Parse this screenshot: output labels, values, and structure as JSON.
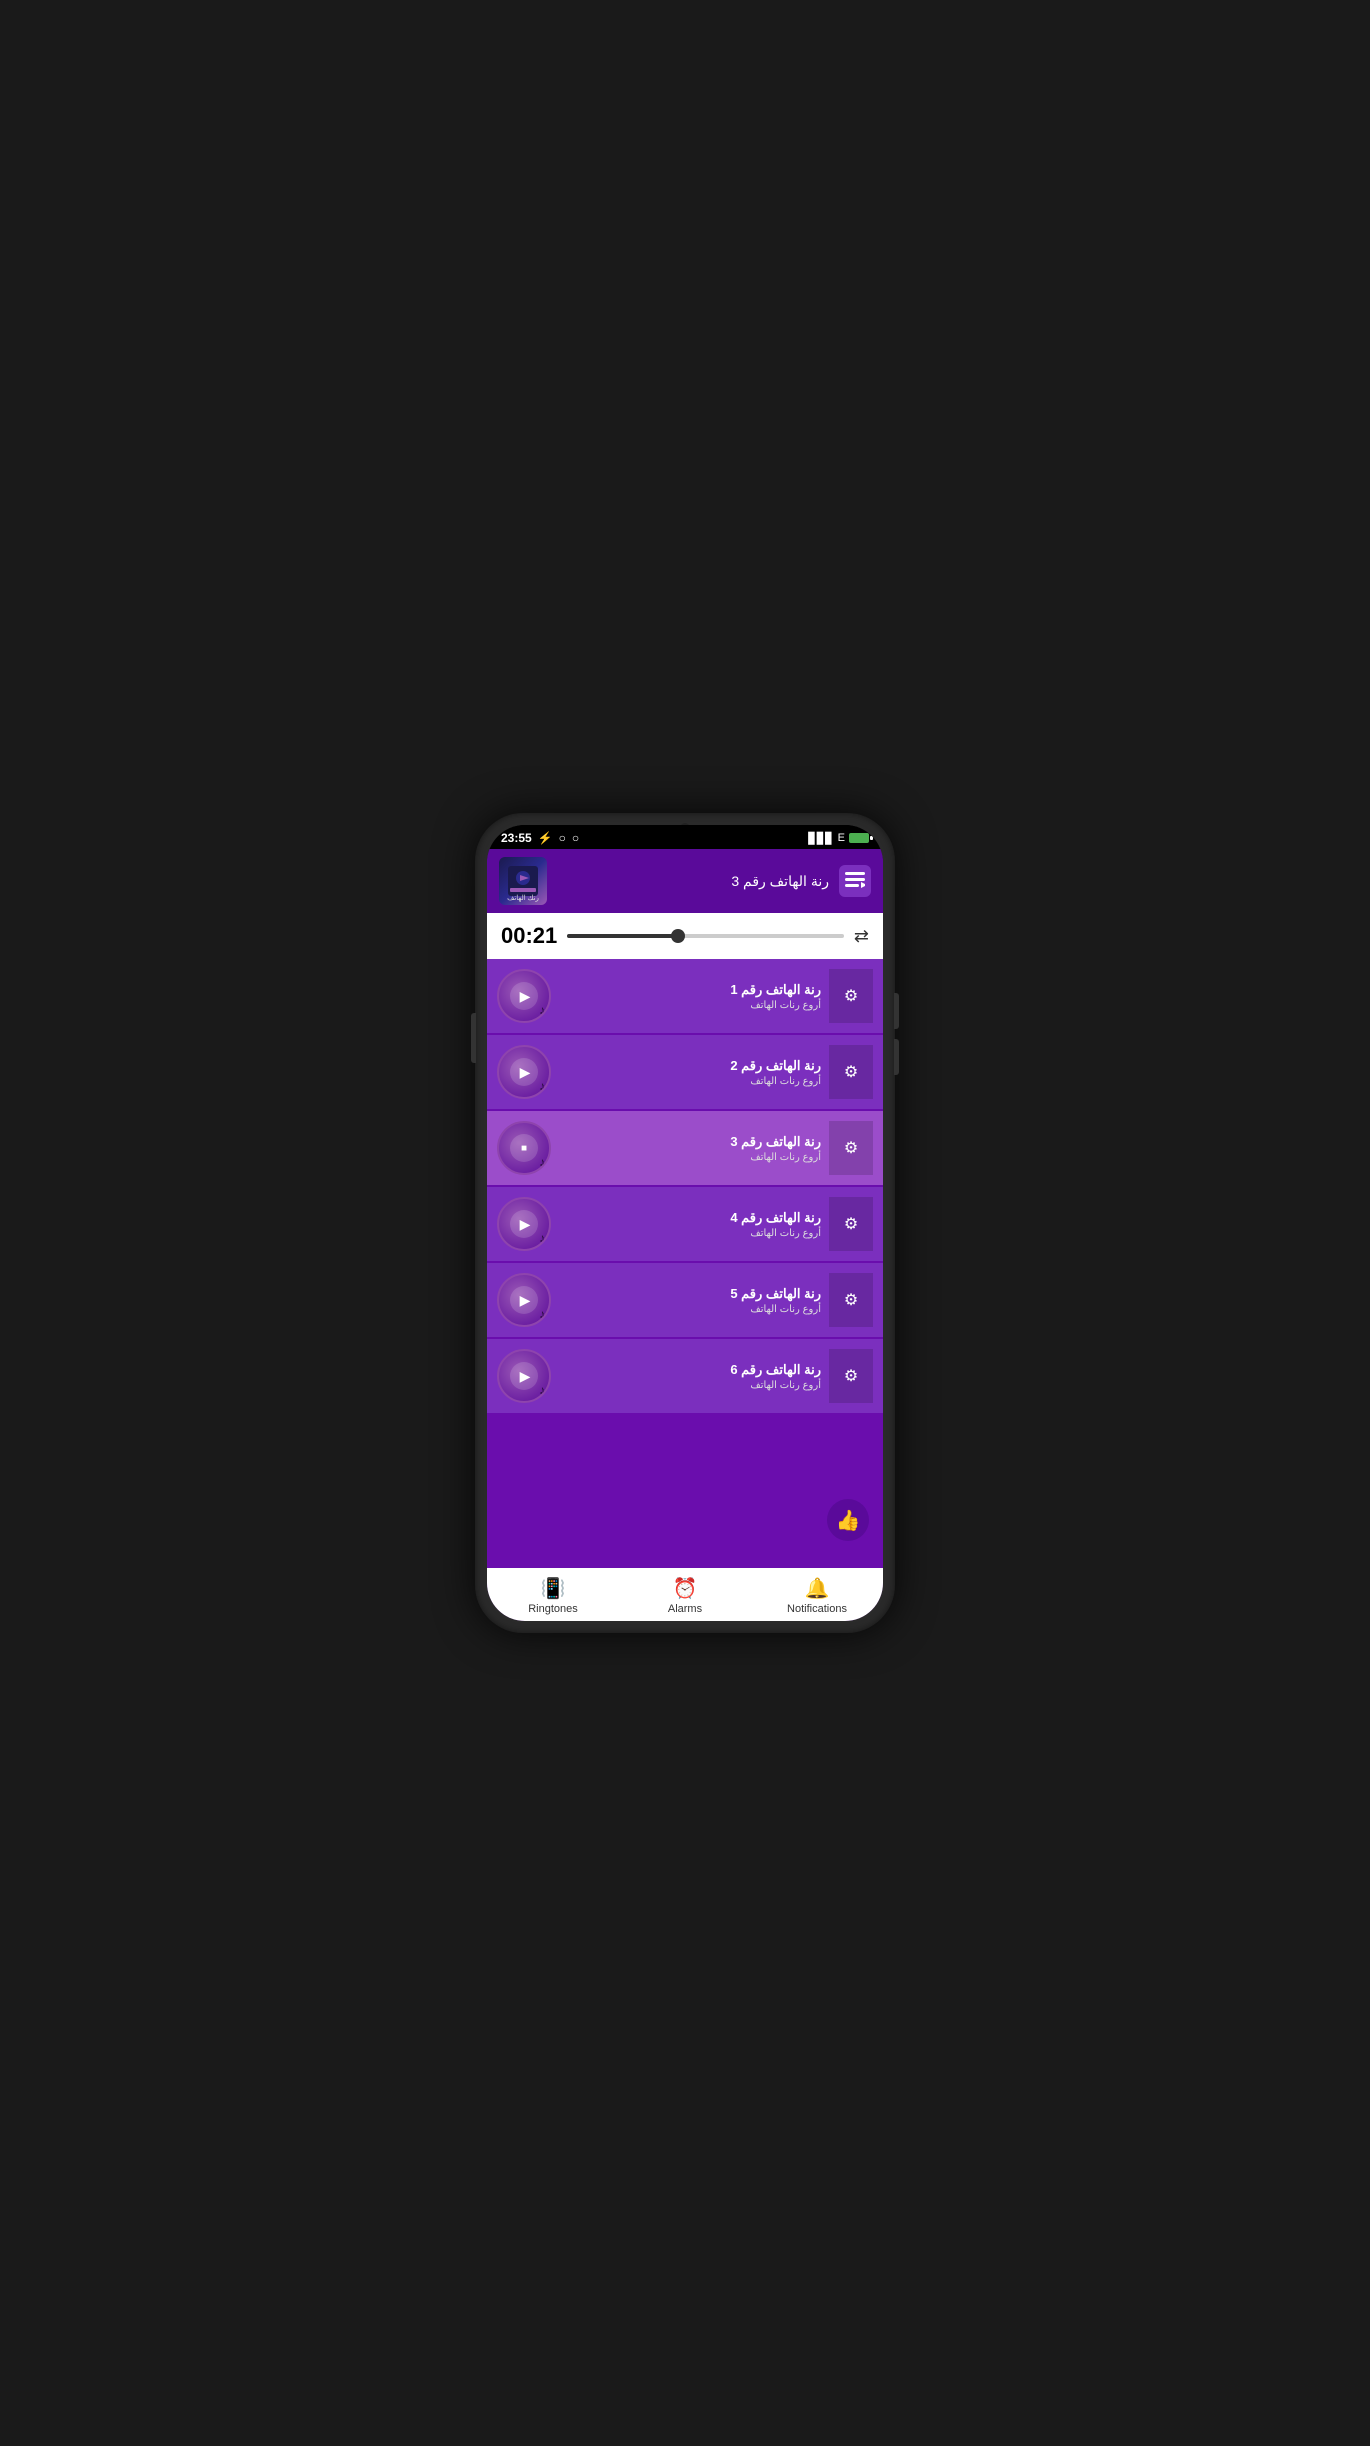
{
  "status_bar": {
    "time": "23:55",
    "signal": "▊▊▊",
    "network": "E",
    "icons_left": [
      "⚡",
      "○",
      "○"
    ]
  },
  "now_playing": {
    "title": "رنة الهاتف رقم 3",
    "thumb_label": "رنك الهاتف",
    "queue_icon": "queue"
  },
  "player": {
    "time": "00:21",
    "progress_percent": 40,
    "repeat_icon": "repeat"
  },
  "tracks": [
    {
      "id": 1,
      "title": "رنة الهاتف رقم 1",
      "subtitle": "أروع رنات الهاتف",
      "playing": false
    },
    {
      "id": 2,
      "title": "رنة الهاتف رقم 2",
      "subtitle": "أروع رنات الهاتف",
      "playing": false
    },
    {
      "id": 3,
      "title": "رنة الهاتف رقم 3",
      "subtitle": "أروع رنات الهاتف",
      "playing": true
    },
    {
      "id": 4,
      "title": "رنة الهاتف رقم 4",
      "subtitle": "أروع رنات الهاتف",
      "playing": false
    },
    {
      "id": 5,
      "title": "رنة الهاتف رقم 5",
      "subtitle": "أروع رنات الهاتف",
      "playing": false
    },
    {
      "id": 6,
      "title": "رنة الهاتف رقم 6",
      "subtitle": "أروع رنات الهاتف",
      "playing": false
    }
  ],
  "bottom_nav": {
    "items": [
      {
        "id": "ringtones",
        "label": "Ringtones",
        "icon": "📳"
      },
      {
        "id": "alarms",
        "label": "Alarms",
        "icon": "⏰"
      },
      {
        "id": "notifications",
        "label": "Notifications",
        "icon": "🔔"
      }
    ]
  },
  "fab": {
    "icon": "👍"
  }
}
